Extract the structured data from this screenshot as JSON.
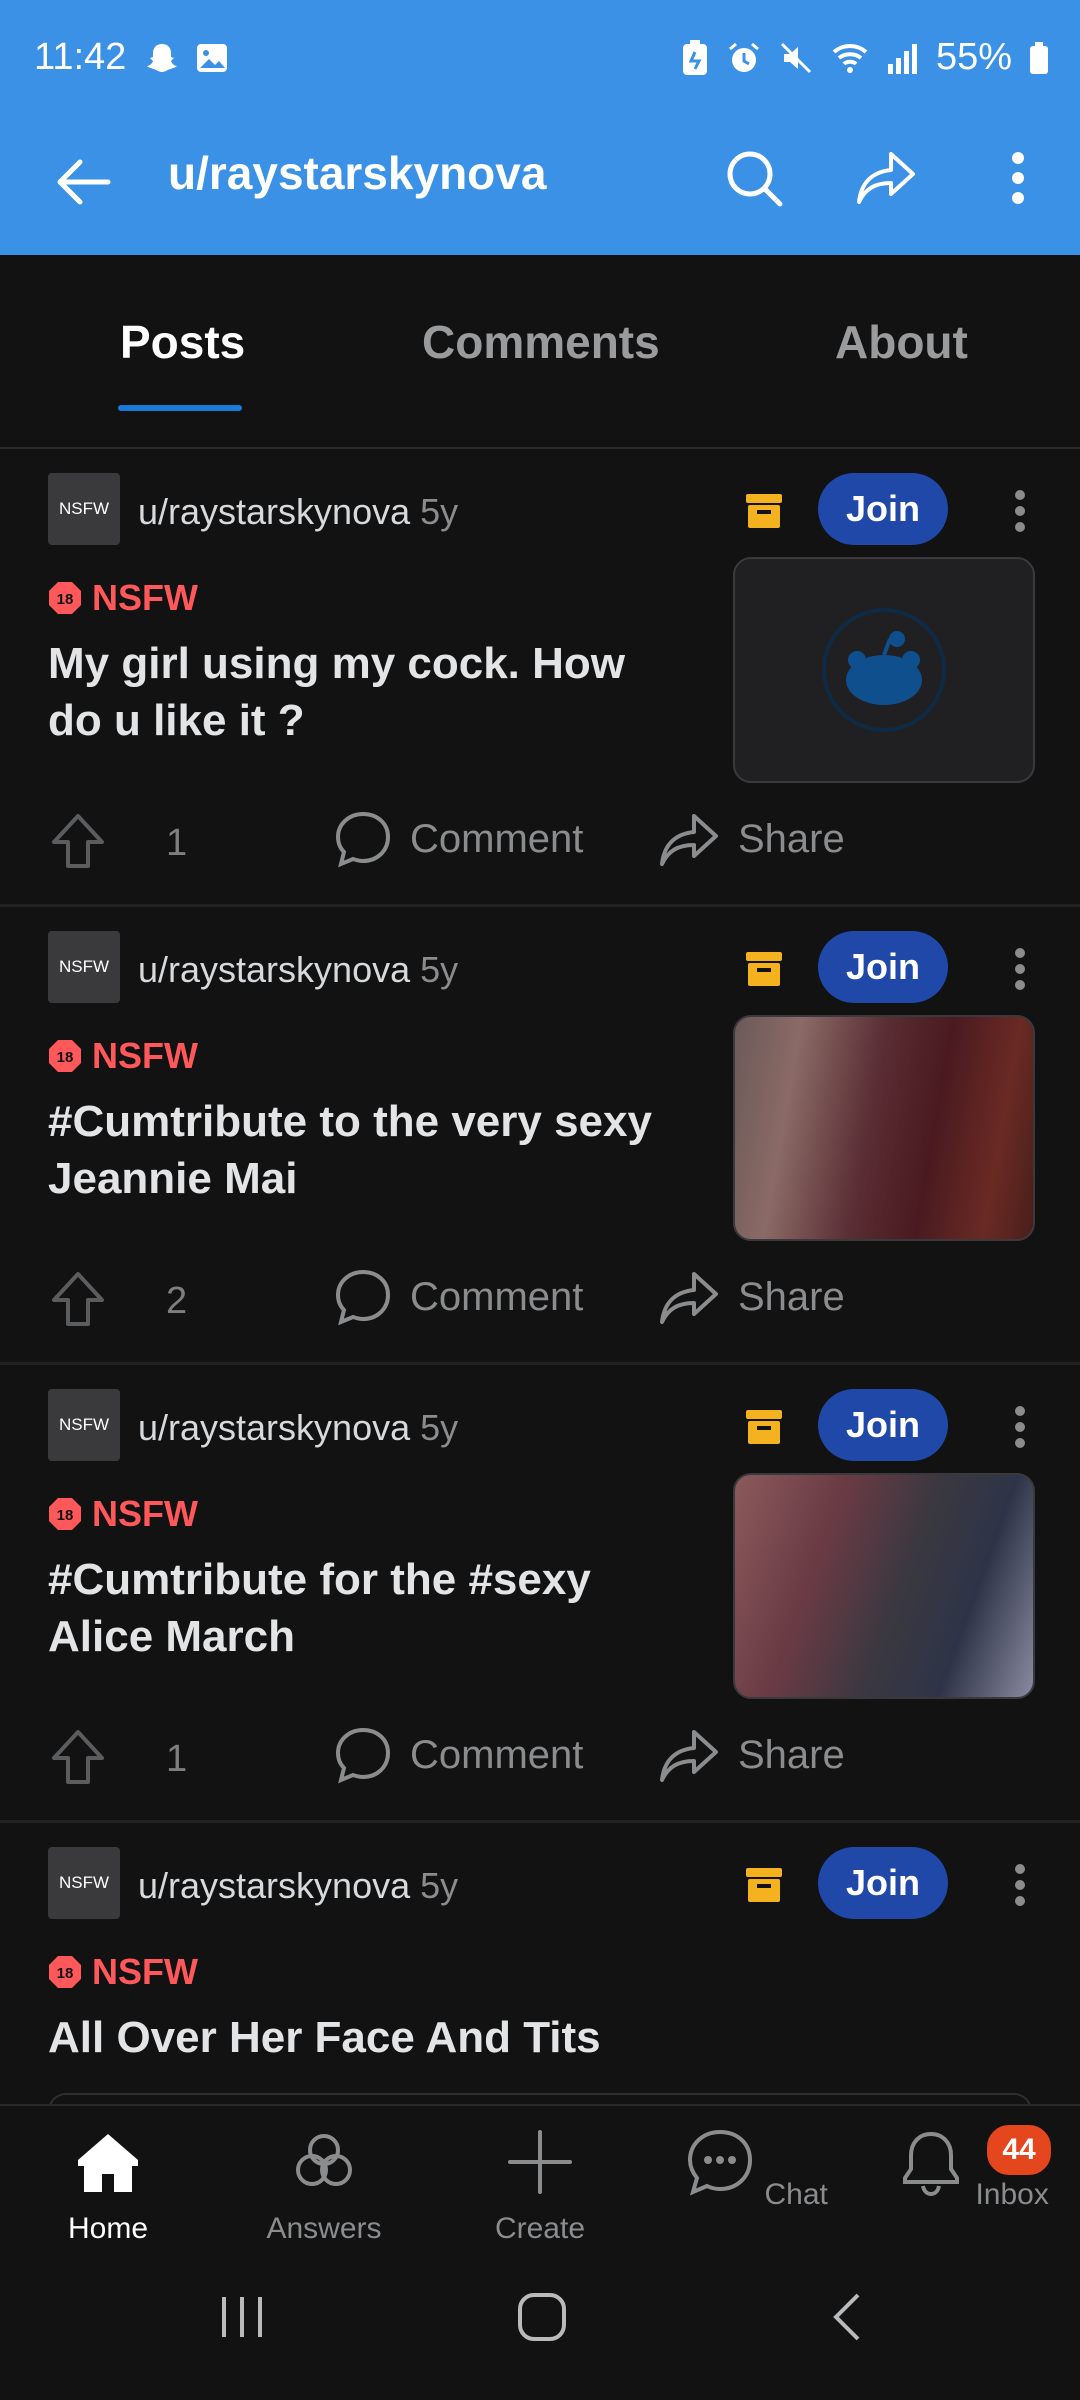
{
  "status": {
    "time": "11:42",
    "battery": "55%"
  },
  "appbar": {
    "title": "u/raystarskynova"
  },
  "tabs": [
    {
      "label": "Posts",
      "active": true
    },
    {
      "label": "Comments",
      "active": false
    },
    {
      "label": "About",
      "active": false
    }
  ],
  "posts": [
    {
      "avatar_text": "NSFW",
      "author": "u/raystarskynova",
      "age": "5y",
      "join_label": "Join",
      "nsfw_label": "NSFW",
      "title": "My girl using my cock. How do u like it ?",
      "score": "1",
      "comment_label": "Comment",
      "share_label": "Share",
      "thumb": "placeholder"
    },
    {
      "avatar_text": "NSFW",
      "author": "u/raystarskynova",
      "age": "5y",
      "join_label": "Join",
      "nsfw_label": "NSFW",
      "title": "#Cumtribute to the very sexy Jeannie Mai",
      "score": "2",
      "comment_label": "Comment",
      "share_label": "Share",
      "thumb": "blurred"
    },
    {
      "avatar_text": "NSFW",
      "author": "u/raystarskynova",
      "age": "5y",
      "join_label": "Join",
      "nsfw_label": "NSFW",
      "title": "#Cumtribute for the #sexy Alice March",
      "score": "1",
      "comment_label": "Comment",
      "share_label": "Share",
      "thumb": "blurred"
    },
    {
      "avatar_text": "NSFW",
      "author": "u/raystarskynova",
      "age": "5y",
      "join_label": "Join",
      "nsfw_label": "NSFW",
      "title": "All Over Her Face And Tits"
    }
  ],
  "bottom_nav": [
    {
      "label": "Home",
      "icon": "home-icon",
      "active": true
    },
    {
      "label": "Answers",
      "icon": "answers-icon",
      "active": false
    },
    {
      "label": "Create",
      "icon": "plus-icon",
      "active": false
    },
    {
      "label": "Chat",
      "icon": "chat-icon",
      "active": false
    },
    {
      "label": "Inbox",
      "icon": "bell-icon",
      "active": false,
      "badge": "44"
    }
  ],
  "colors": {
    "header": "#3b91e5",
    "background": "#121213",
    "join": "#1f48a8",
    "nsfw": "#ff585b",
    "tab_underline": "#1a7ad9",
    "badge": "#e4461d"
  }
}
